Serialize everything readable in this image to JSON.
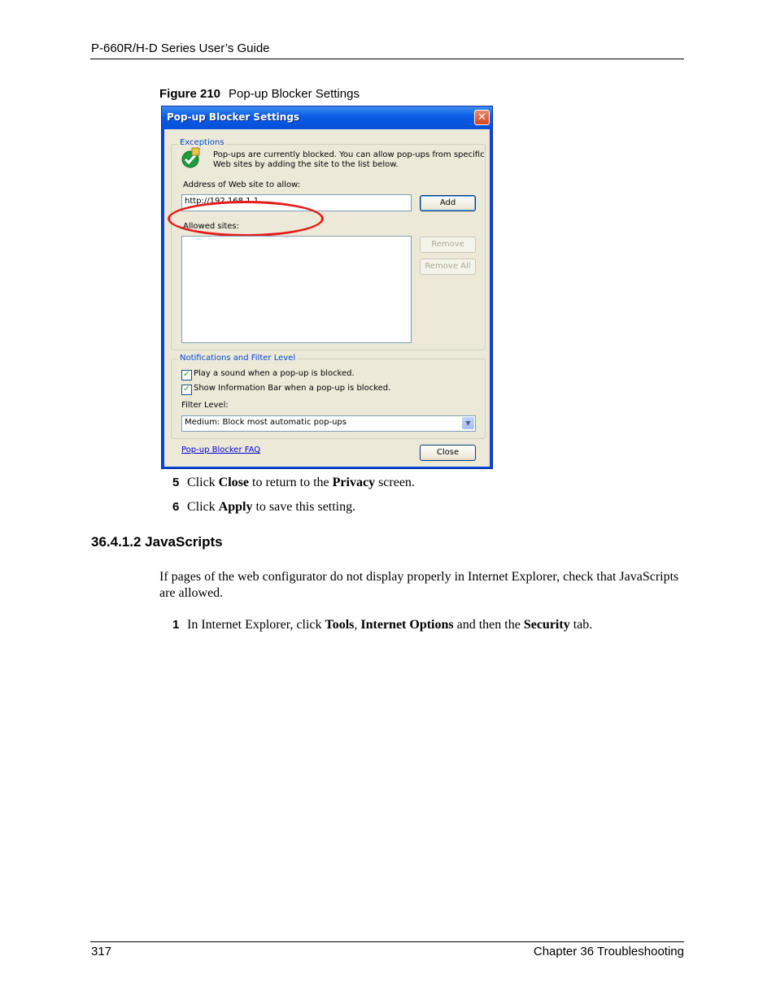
{
  "page": {
    "header": "P-660R/H-D Series User’s Guide",
    "footer_page": "317",
    "footer_chapter": "Chapter 36 Troubleshooting"
  },
  "figure": {
    "label": "Figure 210",
    "caption": "Pop-up Blocker Settings"
  },
  "dialog": {
    "title": "Pop-up Blocker Settings",
    "close_glyph": "✕",
    "exceptions": {
      "legend": "Exceptions",
      "info_line1": "Pop-ups are currently blocked.  You can allow pop-ups from specific",
      "info_line2": "Web sites by adding the site to the list below.",
      "address_label": "Address of Web site to allow:",
      "address_value": "http://192.168.1.1",
      "add_button": "Add",
      "allowed_label": "Allowed sites:",
      "remove_button": "Remove",
      "remove_all_button": "Remove All"
    },
    "notifications": {
      "legend": "Notifications and Filter Level",
      "play_sound": "Play a sound when a pop-up is blocked.",
      "show_info_bar": "Show Information Bar when a pop-up is blocked.",
      "filter_level_label": "Filter Level:",
      "filter_level_value": "Medium: Block most automatic pop-ups"
    },
    "faq_link": "Pop-up Blocker FAQ",
    "close_button": "Close"
  },
  "steps_a": [
    {
      "num": "5",
      "pre": "Click ",
      "bold": "Close",
      "mid": " to return to the ",
      "bold2": "Privacy",
      "post": " screen."
    },
    {
      "num": "6",
      "pre": "Click ",
      "bold": "Apply",
      "post": " to save this setting."
    }
  ],
  "section": {
    "heading": "36.4.1.2  JavaScripts",
    "paragraph": "If pages of the web configurator do not display properly in Internet Explorer, check that JavaScripts are allowed."
  },
  "steps_b": [
    {
      "num": "1",
      "pre": "In Internet Explorer, click ",
      "bold": "Tools",
      "sep": ", ",
      "bold2": "Internet Options",
      "mid": " and then the ",
      "bold3": "Security",
      "post": " tab."
    }
  ]
}
